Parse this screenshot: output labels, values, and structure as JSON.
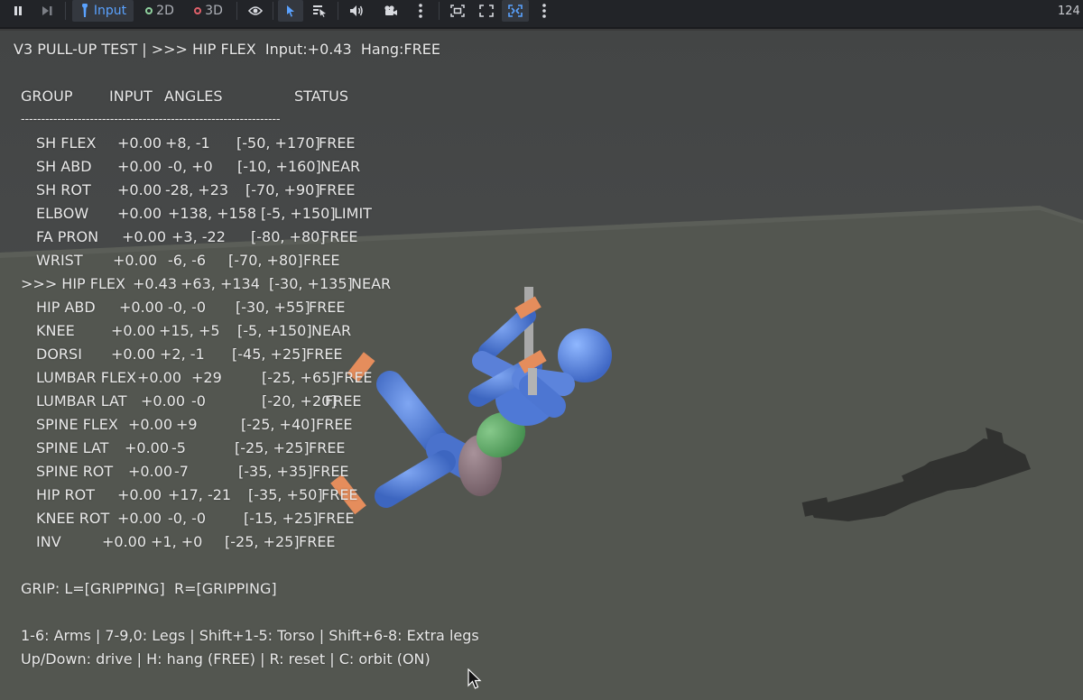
{
  "toolbar": {
    "input_label": "Input",
    "two_d_label": "2D",
    "three_d_label": "3D",
    "right_readout": "124",
    "accent": "#5aa2ff",
    "two_d_color": "#8fd19e",
    "three_d_color": "#e0606a"
  },
  "overlay": {
    "title": "V3 PULL-UP TEST | >>> HIP FLEX  Input:+0.43  Hang:FREE",
    "header": {
      "group": "GROUP",
      "input": "INPUT",
      "angles": "ANGLES",
      "status": "STATUS"
    },
    "divider": "----------------------------------------------------------------",
    "rows": [
      {
        "group": "SH FLEX",
        "input": "+0.00",
        "angles": "+8, -1",
        "range": "[-50, +170]",
        "status": "FREE",
        "selected": false
      },
      {
        "group": "SH ABD",
        "input": "+0.00",
        "angles": "-0, +0",
        "range": "[-10, +160]",
        "status": "NEAR",
        "selected": false
      },
      {
        "group": "SH ROT",
        "input": "+0.00",
        "angles": "-28, +23",
        "range": "[-70, +90]",
        "status": "FREE",
        "selected": false
      },
      {
        "group": "ELBOW",
        "input": "+0.00",
        "angles": "+138, +158",
        "range": "[-5, +150]",
        "status": "LIMIT",
        "selected": false
      },
      {
        "group": "FA PRON",
        "input": "+0.00",
        "angles": "+3, -22",
        "range": "[-80, +80]",
        "status": "FREE",
        "selected": false
      },
      {
        "group": "WRIST",
        "input": "+0.00",
        "angles": "-6, -6",
        "range": "[-70, +80]",
        "status": "FREE",
        "selected": false
      },
      {
        "group": ">>> HIP FLEX",
        "input": "+0.43",
        "angles": "+63, +134",
        "range": "[-30, +135]",
        "status": "NEAR",
        "selected": true
      },
      {
        "group": "HIP ABD",
        "input": "+0.00",
        "angles": "-0, -0",
        "range": "[-30, +55]",
        "status": "FREE",
        "selected": false
      },
      {
        "group": "KNEE",
        "input": "+0.00",
        "angles": "+15, +5",
        "range": "[-5, +150]",
        "status": "NEAR",
        "selected": false
      },
      {
        "group": "DORSI",
        "input": "+0.00",
        "angles": "+2, -1",
        "range": "[-45, +25]",
        "status": "FREE",
        "selected": false
      },
      {
        "group": "LUMBAR FLEX",
        "input": "+0.00",
        "angles": "+29",
        "range": "[-25, +65]",
        "status": "FREE",
        "selected": false
      },
      {
        "group": "LUMBAR LAT",
        "input": "+0.00",
        "angles": "-0",
        "range": "[-20, +20]",
        "status": "FREE",
        "selected": false
      },
      {
        "group": "SPINE FLEX",
        "input": "+0.00",
        "angles": "+9",
        "range": "[-25, +40]",
        "status": "FREE",
        "selected": false
      },
      {
        "group": "SPINE LAT",
        "input": "+0.00",
        "angles": "-5",
        "range": "[-25, +25]",
        "status": "FREE",
        "selected": false
      },
      {
        "group": "SPINE ROT",
        "input": "+0.00",
        "angles": "-7",
        "range": "[-35, +35]",
        "status": "FREE",
        "selected": false
      },
      {
        "group": "HIP ROT",
        "input": "+0.00",
        "angles": "+17, -21",
        "range": "[-35, +50]",
        "status": "FREE",
        "selected": false
      },
      {
        "group": "KNEE ROT",
        "input": "+0.00",
        "angles": "-0, -0",
        "range": "[-15, +25]",
        "status": "FREE",
        "selected": false
      },
      {
        "group": "INV",
        "input": "+0.00",
        "angles": "+1, +0",
        "range": "[-25, +25]",
        "status": "FREE",
        "selected": false
      }
    ],
    "grip": "GRIP: L=[GRIPPING]  R=[GRIPPING]",
    "help_line_1": "1-6: Arms | 7-9,0: Legs | Shift+1-5: Torso | Shift+6-8: Extra legs",
    "help_line_2": "Up/Down: drive | H: hang (FREE) | R: reset | C: orbit (ON)"
  }
}
